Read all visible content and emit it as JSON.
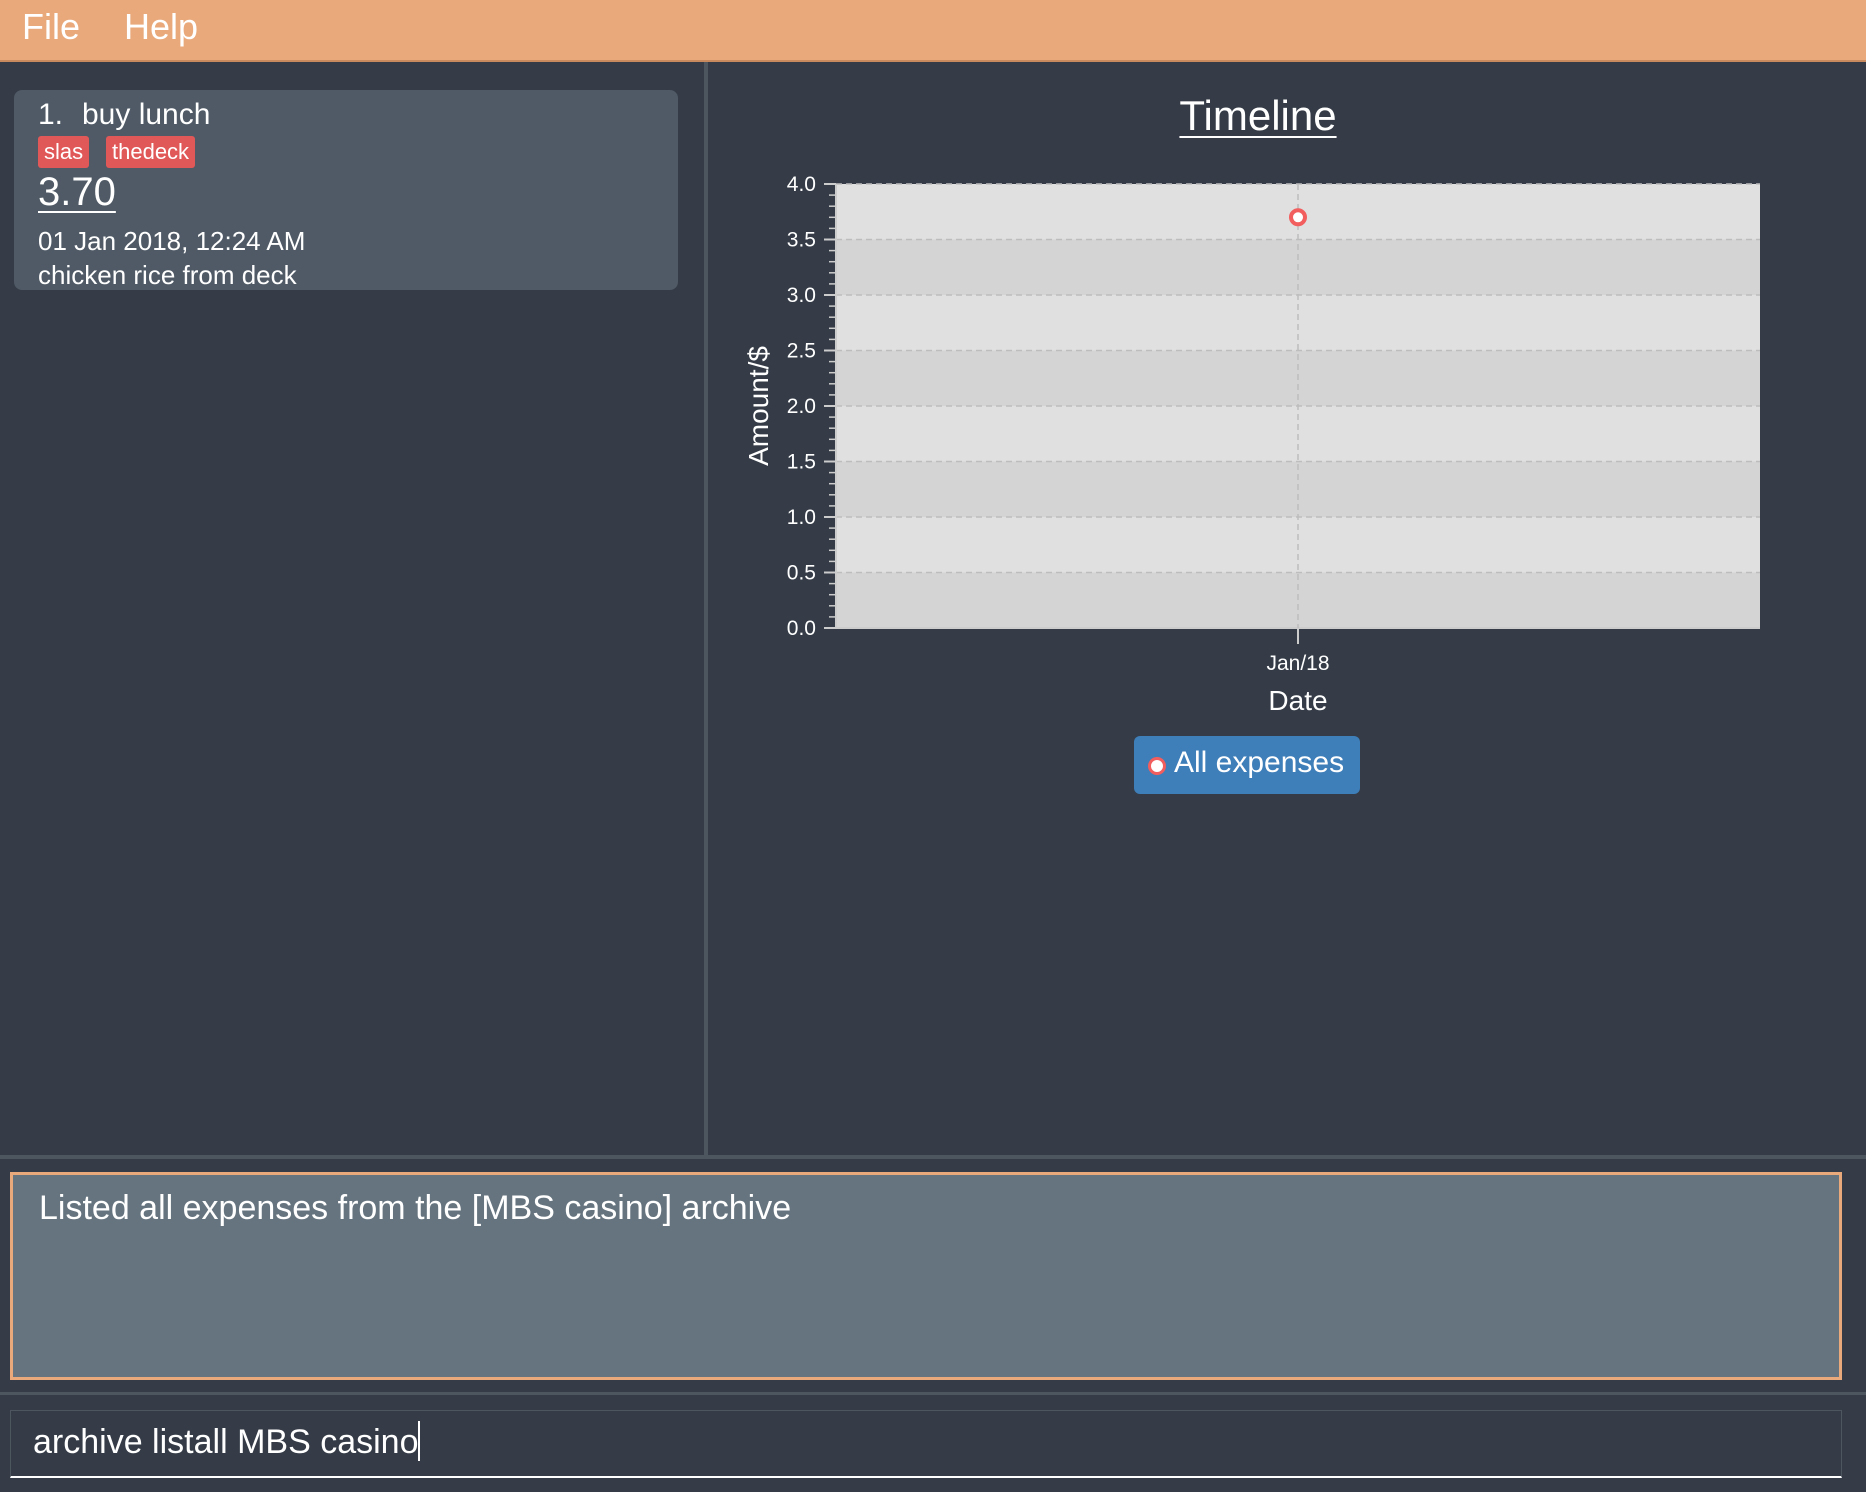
{
  "menu": {
    "items": [
      "File",
      "Help"
    ]
  },
  "expenses": [
    {
      "index": "1.",
      "name": "buy lunch",
      "tags": [
        "slas",
        "thedeck"
      ],
      "amount": "3.70",
      "date": "01 Jan 2018, 12:24 AM",
      "description": "chicken rice from deck"
    }
  ],
  "chart_data": {
    "type": "scatter",
    "title": "Timeline",
    "xlabel": "Date",
    "ylabel": "Amount/$",
    "x_tick_labels": [
      "Jan/18"
    ],
    "y_ticks": [
      0.0,
      0.5,
      1.0,
      1.5,
      2.0,
      2.5,
      3.0,
      3.5,
      4.0
    ],
    "ylim": [
      0,
      4.0
    ],
    "grid": true,
    "legend_position": "bottom",
    "series": [
      {
        "name": "All expenses",
        "points": [
          {
            "x": "Jan/18",
            "y": 3.7
          }
        ],
        "color": "#f25d5d"
      }
    ]
  },
  "result": {
    "message": "Listed all expenses from the [MBS casino] archive"
  },
  "command": {
    "value": "archive listall MBS casino"
  },
  "colors": {
    "menubar": "#e9a97b",
    "background": "#353c47",
    "tag": "#e15858",
    "legend": "#3e7eb9",
    "marker": "#f25d5d"
  }
}
